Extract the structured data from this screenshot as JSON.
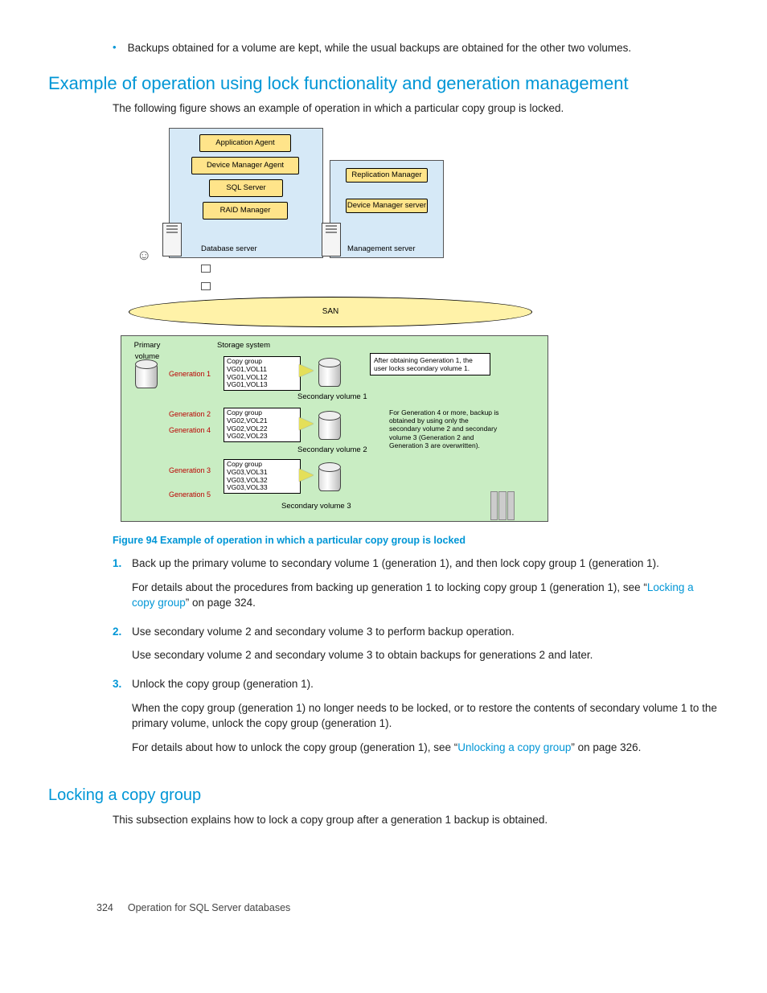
{
  "bullet": "Backups obtained for a volume are kept, while the usual backups are obtained for the other two volumes.",
  "h2": "Example of operation using lock functionality and generation management",
  "intro": "The following figure shows an example of operation in which a particular copy group is locked.",
  "diagram": {
    "app_agent": "Application Agent",
    "dev_mgr_agent": "Device Manager Agent",
    "sql_server": "SQL Server",
    "raid_mgr": "RAID Manager",
    "db_server": "Database server",
    "repl_mgr": "Replication Manager",
    "dev_mgr_server": "Device Manager server",
    "mgmt_server": "Management server",
    "san": "SAN",
    "primary_volume": "Primary volume",
    "storage_system": "Storage system",
    "gen1": "Generation 1",
    "gen2": "Generation 2",
    "gen3": "Generation 3",
    "gen4": "Generation 4",
    "gen5": "Generation 5",
    "cg1_title": "Copy group",
    "cg1_l1": "VG01,VOL11",
    "cg1_l2": "VG01,VOL12",
    "cg1_l3": "VG01,VOL13",
    "cg2_l1": "VG02,VOL21",
    "cg2_l2": "VG02,VOL22",
    "cg2_l3": "VG02,VOL23",
    "cg3_l1": "VG03,VOL31",
    "cg3_l2": "VG03,VOL32",
    "cg3_l3": "VG03,VOL33",
    "sv1": "Secondary volume 1",
    "sv2": "Secondary volume 2",
    "sv3": "Secondary volume 3",
    "note1": "After obtaining Generation 1, the user locks secondary volume 1.",
    "note2": "For Generation 4 or more, backup is obtained by using only the secondary volume 2 and secondary volume 3 (Generation 2 and Generation 3 are overwritten)."
  },
  "figcaption": "Figure 94 Example of operation in which a particular copy group is locked",
  "steps": [
    {
      "num": "1.",
      "p1": "Back up the primary volume to secondary volume 1 (generation 1), and then lock copy group 1 (generation 1).",
      "p2a": "For details about the procedures from backing up generation 1 to locking copy group 1 (generation 1), see “",
      "p2link": "Locking a copy group",
      "p2b": "” on page 324."
    },
    {
      "num": "2.",
      "p1": "Use secondary volume 2 and secondary volume 3 to perform backup operation.",
      "p2": "Use secondary volume 2 and secondary volume 3 to obtain backups for generations 2 and later."
    },
    {
      "num": "3.",
      "p1": "Unlock the copy group (generation 1).",
      "p2": "When the copy group (generation 1) no longer needs to be locked, or to restore the contents of secondary volume 1 to the primary volume, unlock the copy group (generation 1).",
      "p3a": "For details about how to unlock the copy group (generation 1), see “",
      "p3link": "Unlocking a copy group",
      "p3b": "” on page 326."
    }
  ],
  "h3": "Locking a copy group",
  "sub_intro": "This subsection explains how to lock a copy group after a generation 1 backup is obtained.",
  "footer_page": "324",
  "footer_text": "Operation for SQL Server databases"
}
